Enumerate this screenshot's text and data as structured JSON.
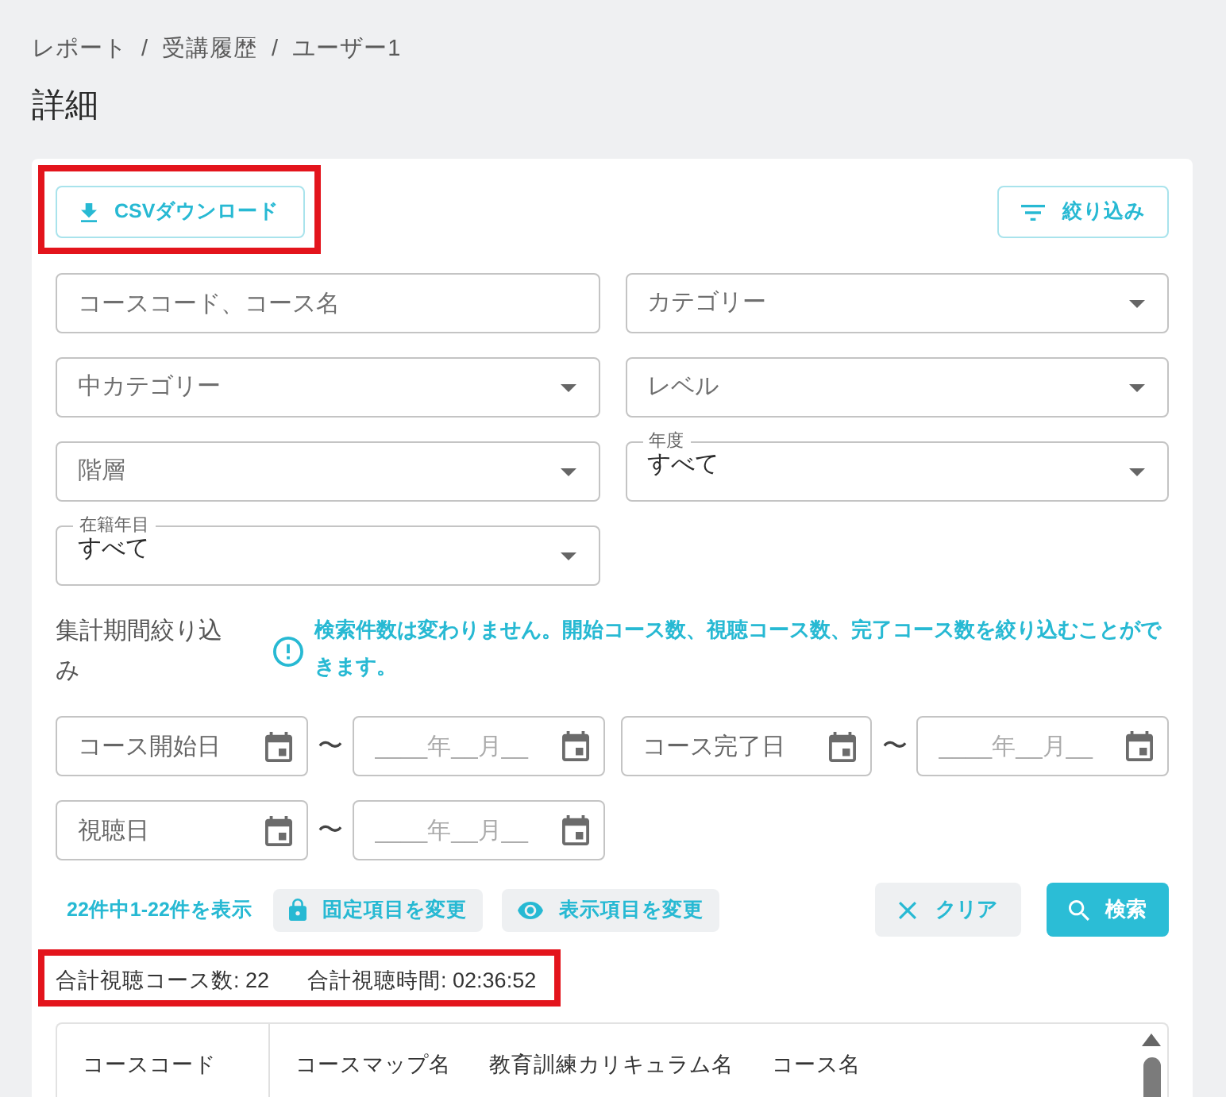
{
  "breadcrumb": {
    "items": [
      "レポート",
      "受講履歴",
      "ユーザー1"
    ],
    "separators": [
      "/",
      "/"
    ]
  },
  "title": "詳細",
  "toolbar": {
    "csv_button": {
      "label": "CSVダウンロード",
      "highlighted": true
    },
    "filter_button": {
      "label": "絞り込み"
    }
  },
  "filters": [
    {
      "kind": "text",
      "placeholder": "コースコード、コース名"
    },
    {
      "kind": "select",
      "placeholder": "中カテゴリー"
    },
    {
      "kind": "select",
      "placeholder": "階層"
    },
    {
      "kind": "select",
      "label": "在籍年目",
      "value": "すべて"
    },
    {
      "kind": "select",
      "placeholder": "カテゴリー"
    },
    {
      "kind": "select",
      "placeholder": "レベル"
    },
    {
      "kind": "select",
      "label": "年度",
      "value": "すべて"
    }
  ],
  "period": {
    "label": "集計期間絞り込み",
    "note": "検索件数は変わりません。開始コース数、視聴コース数、完了コース数を絞り込むことができます。",
    "ranges": [
      {
        "from": {
          "label": "コース開始日"
        },
        "separator": "〜",
        "to": {
          "placeholder": "____年__月__"
        }
      },
      {
        "from": {
          "label": "コース完了日"
        },
        "separator": "〜",
        "to": {
          "placeholder": "____年__月__"
        }
      },
      {
        "from": {
          "label": "視聴日"
        },
        "separator": "〜",
        "to": {
          "placeholder": "____年__月__"
        }
      }
    ]
  },
  "actions": {
    "result_count": "22件中1-22件を表示",
    "column_buttons": [
      {
        "kind": "lock",
        "label": "固定項目を変更"
      },
      {
        "kind": "eye",
        "label": "表示項目を変更"
      }
    ],
    "clear_button": "クリア",
    "search_button": "検索"
  },
  "summary": {
    "highlighted": true,
    "items": [
      "合計視聴コース数: 22",
      "合計視聴時間: 02:36:52"
    ]
  },
  "table": {
    "columns": [
      {
        "label": "コースコード",
        "fixed": true
      },
      {
        "label": "コースマップ名",
        "fixed": false
      },
      {
        "label": "教育訓練カリキュラム名",
        "fixed": false
      },
      {
        "label": "コース名",
        "fixed": false
      }
    ]
  }
}
